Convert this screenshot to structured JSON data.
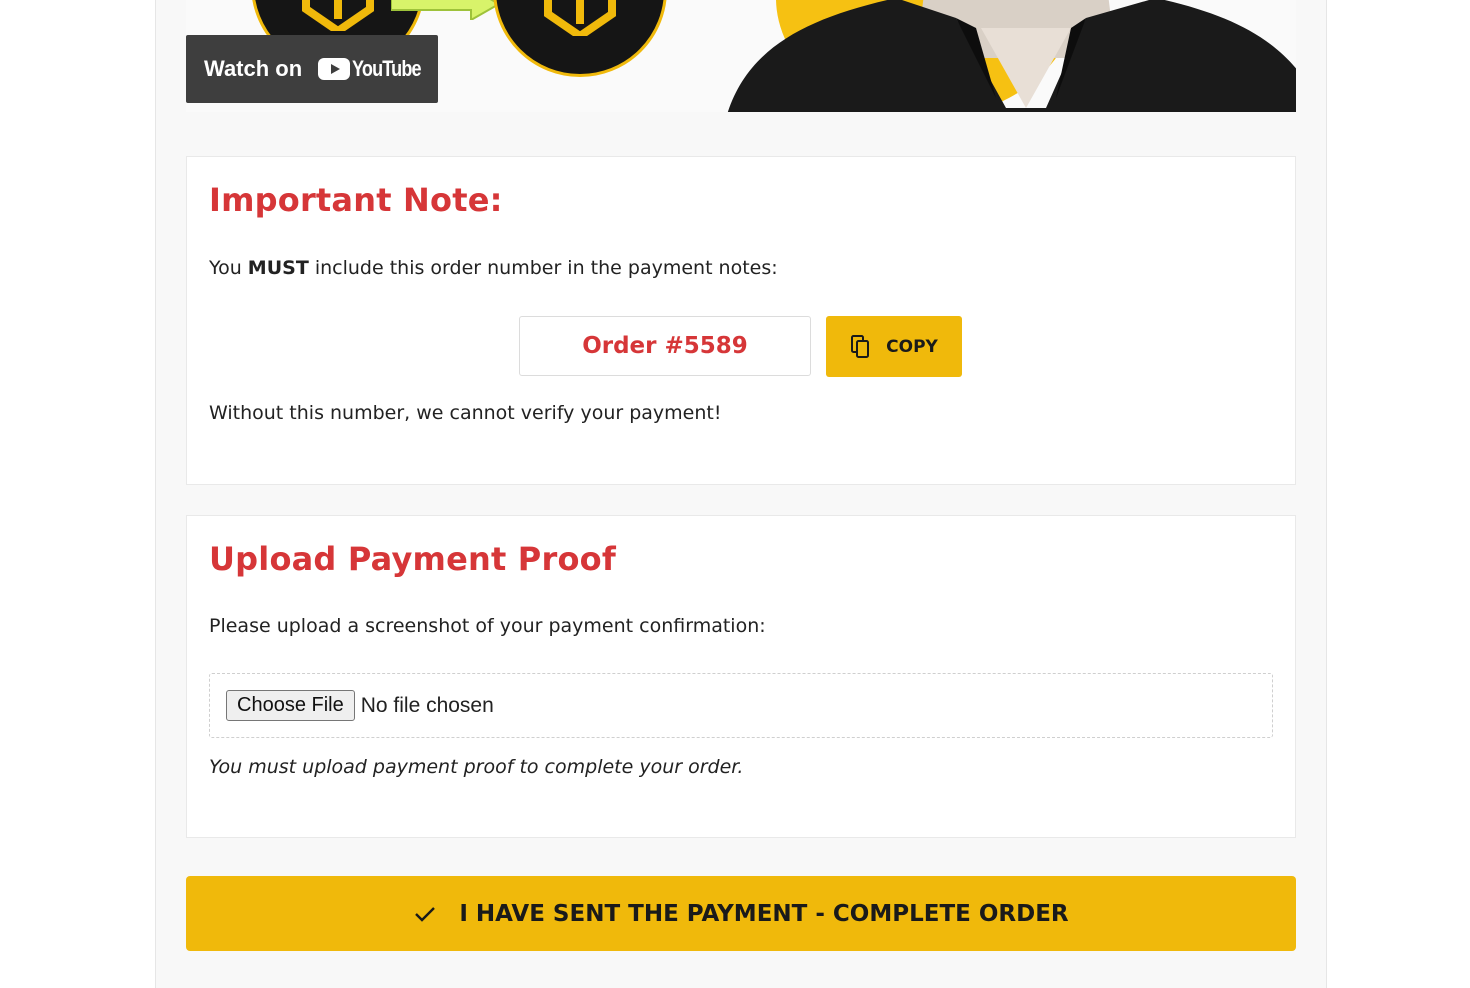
{
  "video": {
    "watch_label": "Watch on",
    "brand_label": "YouTube",
    "accent_color": "#f0b90b"
  },
  "note_card": {
    "title": "Important Note:",
    "instruction_prefix": "You ",
    "instruction_emphasis": "MUST",
    "instruction_suffix": " include this order number in the payment notes:",
    "order_number": "Order #5589",
    "copy_label": "COPY",
    "warning": "Without this number, we cannot verify your payment!"
  },
  "upload_card": {
    "title": "Upload Payment Proof",
    "instruction": "Please upload a screenshot of your payment confirmation:",
    "choose_file_label": "Choose File",
    "file_status": "No file chosen",
    "hint": "You must upload payment proof to complete your order."
  },
  "complete_button": {
    "label": "I HAVE SENT THE PAYMENT - COMPLETE ORDER"
  },
  "colors": {
    "accent": "#f0b90b",
    "heading_red": "#d63638"
  }
}
